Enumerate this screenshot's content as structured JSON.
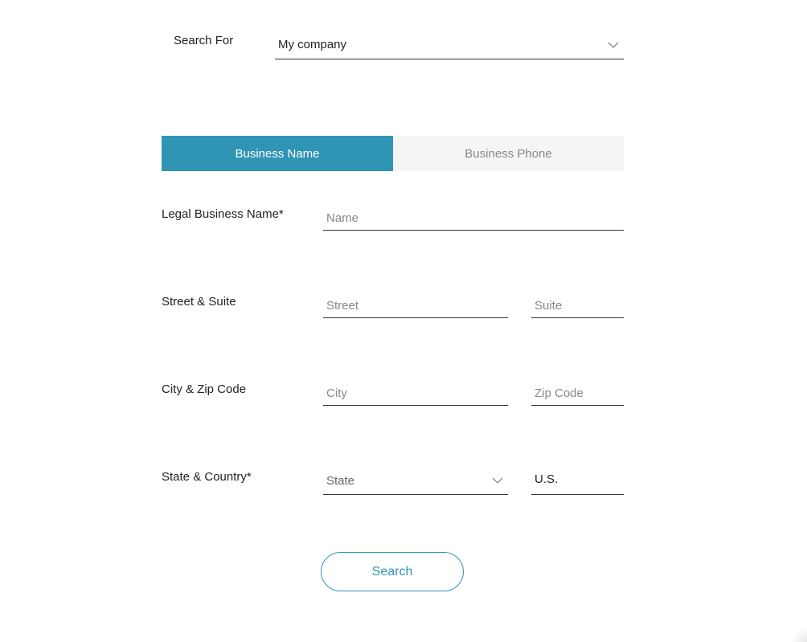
{
  "search_for": {
    "label": "Search For",
    "selected": "My company"
  },
  "tabs": [
    {
      "label": "Business Name",
      "active": true
    },
    {
      "label": "Business Phone",
      "active": false
    }
  ],
  "form": {
    "legal_name": {
      "label": "Legal Business Name*",
      "placeholder": "Name"
    },
    "street_suite": {
      "label": "Street & Suite",
      "street_placeholder": "Street",
      "suite_placeholder": "Suite"
    },
    "city_zip": {
      "label": "City & Zip Code",
      "city_placeholder": "City",
      "zip_placeholder": "Zip Code"
    },
    "state_country": {
      "label": "State & Country*",
      "state_placeholder": "State",
      "country_value": "U.S."
    }
  },
  "search_button": "Search",
  "colors": {
    "accent": "#3094b4",
    "tab_inactive_bg": "#f5f5f5"
  }
}
